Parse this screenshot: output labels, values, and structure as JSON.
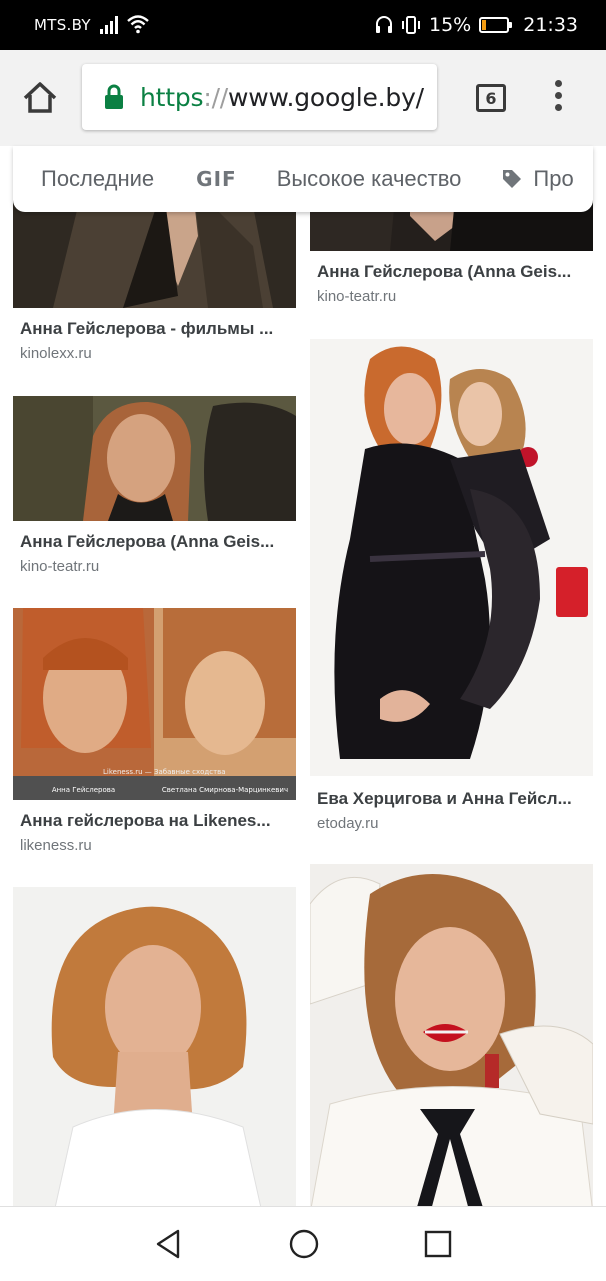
{
  "status_bar": {
    "carrier": "MTS.BY",
    "battery_text": "15%",
    "battery_level": 0.15,
    "time": "21:33"
  },
  "toolbar": {
    "url_scheme": "https",
    "url_sep": "://",
    "url_host": "www.google.by/",
    "tab_count": "6"
  },
  "chips": [
    "Последние",
    "GIF",
    "Высокое качество",
    "Про"
  ],
  "results": [
    {
      "title": "Анна Гейслерова - фильмы ...",
      "site": "kinolexx.ru"
    },
    {
      "title": "Анна Гейслерова (Anna Geis...",
      "site": "kino-teatr.ru"
    },
    {
      "title": "Анна Гейслерова (Anna Geis...",
      "site": "kino-teatr.ru"
    },
    {
      "title": "Анна гейслерова на Likenes...",
      "site": "likeness.ru"
    },
    {
      "title": "Ева Херцигова и Анна Гейсл...",
      "site": "etoday.ru"
    },
    {
      "title": "",
      "site": ""
    },
    {
      "title": "",
      "site": ""
    }
  ],
  "likeness_captions": {
    "watermark": "Likeness.ru — Забавные сходства",
    "left": "Анна Гейслерова",
    "right": "Светлана Смирнова-Марцинкевич"
  },
  "icons": {
    "home": "home-icon",
    "lock": "lock-icon",
    "menu": "overflow-menu-icon",
    "tag": "tag-icon",
    "back": "back-triangle-icon",
    "home_nav": "home-circle-icon",
    "recents": "recents-square-icon"
  },
  "colors": {
    "url_scheme": "#0b8043",
    "battery": "#f39c12",
    "toolbar_bg": "#f2f2f2"
  }
}
